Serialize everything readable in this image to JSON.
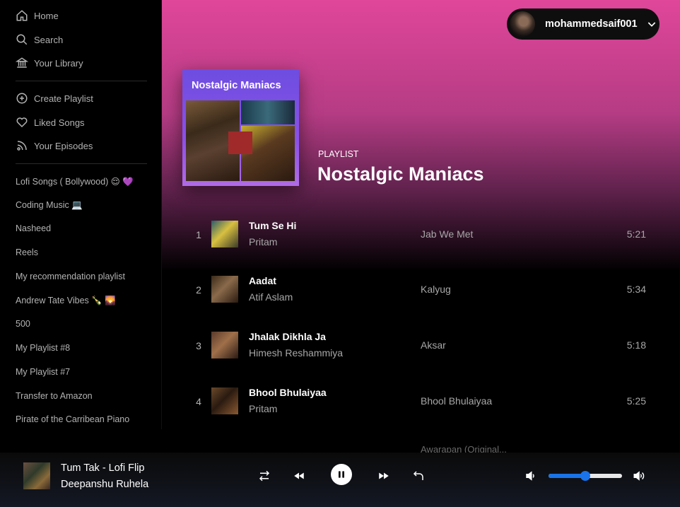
{
  "nav": {
    "home": "Home",
    "search": "Search",
    "library": "Your Library",
    "create_playlist": "Create Playlist",
    "liked_songs": "Liked Songs",
    "your_episodes": "Your Episodes"
  },
  "playlists": [
    "Lofi Songs ( Bollywood) 😌 💜",
    "Coding Music 💻",
    "Nasheed",
    "Reels",
    "My recommendation playlist",
    "Andrew Tate Vibes 🍾 🌄",
    "500",
    "My Playlist #8",
    "My Playlist #7",
    "Transfer to Amazon",
    "Pirate of the Carribean Piano"
  ],
  "user": {
    "name": "mohammedsaif001"
  },
  "playlist": {
    "type": "PLAYLIST",
    "title": "Nostalgic Maniacs",
    "cover_title": "Nostalgic Maniacs"
  },
  "tracks": [
    {
      "num": "1",
      "title": "Tum Se Hi",
      "artist": "Pritam",
      "album": "Jab We Met",
      "duration": "5:21"
    },
    {
      "num": "2",
      "title": "Aadat",
      "artist": "Atif Aslam",
      "album": "Kalyug",
      "duration": "5:34"
    },
    {
      "num": "3",
      "title": "Jhalak Dikhla Ja",
      "artist": "Himesh Reshammiya",
      "album": "Aksar",
      "duration": "5:18"
    },
    {
      "num": "4",
      "title": "Bhool Bhulaiyaa",
      "artist": "Pritam",
      "album": "Bhool Bhulaiyaa",
      "duration": "5:25"
    }
  ],
  "partial_album": "Awarapan (Original...",
  "now_playing": {
    "title": "Tum Tak - Lofi Flip",
    "artist": "Deepanshu Ruhela"
  },
  "volume": {
    "level": 0.5
  },
  "colors": {
    "accent": "#1a73e8",
    "header_gradient_top": "#e0469a"
  },
  "icons": [
    "home-icon",
    "search-icon",
    "library-icon",
    "plus-circle-icon",
    "heart-icon",
    "podcast-icon",
    "chevron-down-icon",
    "shuffle-icon",
    "previous-icon",
    "pause-icon",
    "next-icon",
    "repeat-icon",
    "volume-low-icon",
    "volume-high-icon"
  ]
}
